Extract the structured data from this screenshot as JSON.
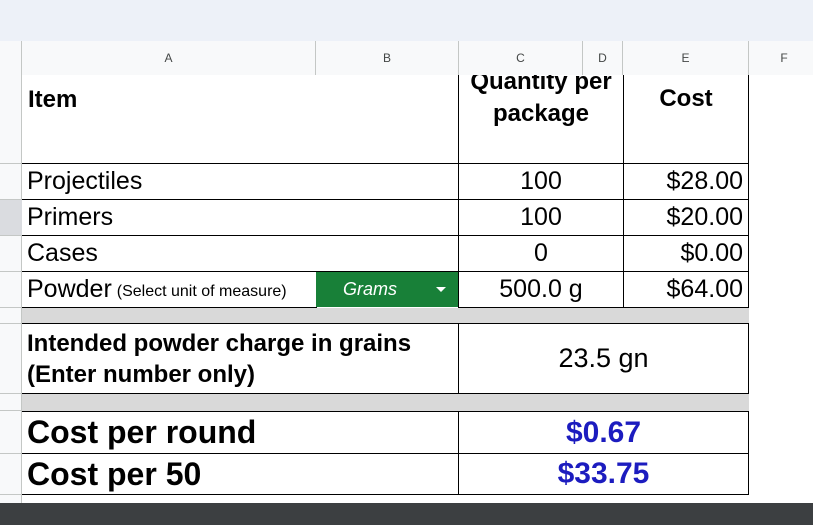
{
  "columns": [
    "A",
    "B",
    "C",
    "D",
    "E",
    "F"
  ],
  "header": {
    "item": "Item",
    "qty_line1": "Quantity per",
    "qty_line2": "package",
    "cost": "Cost"
  },
  "rows": [
    {
      "item": "Projectiles",
      "qty": "100",
      "cost": "$28.00"
    },
    {
      "item": "Primers",
      "qty": "100",
      "cost": "$20.00"
    },
    {
      "item": "Cases",
      "qty": "0",
      "cost": "$0.00"
    },
    {
      "item": "Powder",
      "item_note": "(Select unit of measure)",
      "unit": "Grams",
      "qty": "500.0 g",
      "cost": "$64.00"
    }
  ],
  "charge": {
    "label_line1": "Intended powder charge in grains",
    "label_line2": "(Enter number only)",
    "value": "23.5 gn"
  },
  "results": [
    {
      "label": "Cost per round",
      "value": "$0.67"
    },
    {
      "label": "Cost per 50",
      "value": "$33.75"
    }
  ],
  "colors": {
    "dropdown": "#188038",
    "result_text": "#1c1cbf",
    "band": "#d9d9d9"
  }
}
